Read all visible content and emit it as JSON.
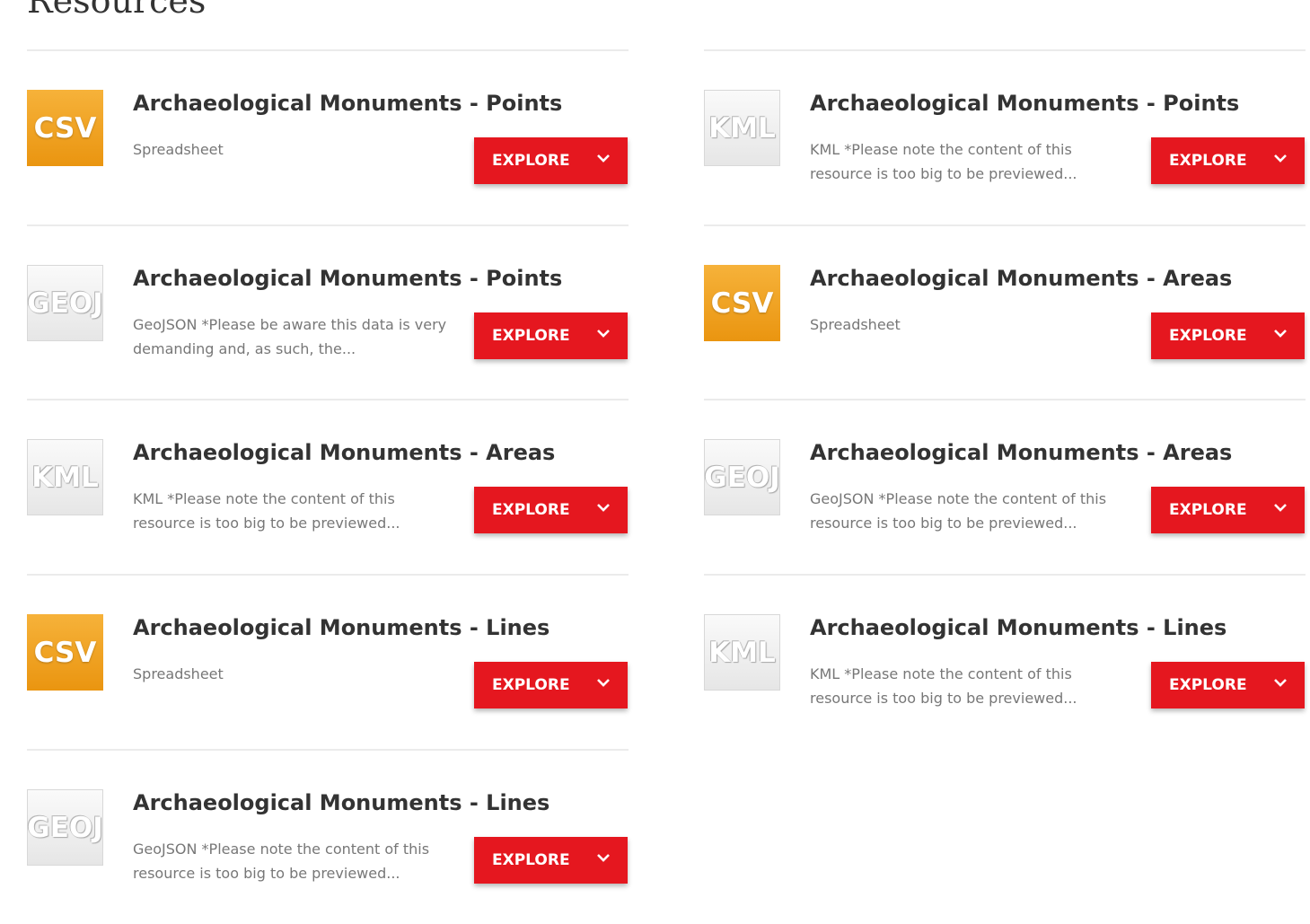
{
  "page": {
    "heading": "Resources"
  },
  "resources": [
    {
      "title": "Archaeological Monuments - Points",
      "format": "CSV",
      "description": "Spreadsheet",
      "button": "EXPLORE"
    },
    {
      "title": "Archaeological Monuments - Points",
      "format": "KML",
      "description": "KML *Please note the content of this resource is too big to be previewed...",
      "button": "EXPLORE"
    },
    {
      "title": "Archaeological Monuments - Points",
      "format": "GEOJ",
      "description": "GeoJSON *Please be aware this data is very demanding and, as such, the...",
      "button": "EXPLORE"
    },
    {
      "title": "Archaeological Monuments - Areas",
      "format": "CSV",
      "description": "Spreadsheet",
      "button": "EXPLORE"
    },
    {
      "title": "Archaeological Monuments - Areas",
      "format": "KML",
      "description": "KML *Please note the content of this resource is too big to be previewed...",
      "button": "EXPLORE"
    },
    {
      "title": "Archaeological Monuments - Areas",
      "format": "GEOJ",
      "description": "GeoJSON *Please note the content of this resource is too big to be previewed...",
      "button": "EXPLORE"
    },
    {
      "title": "Archaeological Monuments - Lines",
      "format": "CSV",
      "description": "Spreadsheet",
      "button": "EXPLORE"
    },
    {
      "title": "Archaeological Monuments - Lines",
      "format": "KML",
      "description": "KML *Please note the content of this resource is too big to be previewed...",
      "button": "EXPLORE"
    },
    {
      "title": "Archaeological Monuments - Lines",
      "format": "GEOJ",
      "description": "GeoJSON *Please note the content of this resource is too big to be previewed...",
      "button": "EXPLORE"
    }
  ],
  "icons": {
    "explore_dropdown": "chevron-down-icon"
  },
  "colors": {
    "explore_button": "#e5171f",
    "csv_badge": "#f0a11f",
    "format_badge_gray": "#ececec"
  }
}
